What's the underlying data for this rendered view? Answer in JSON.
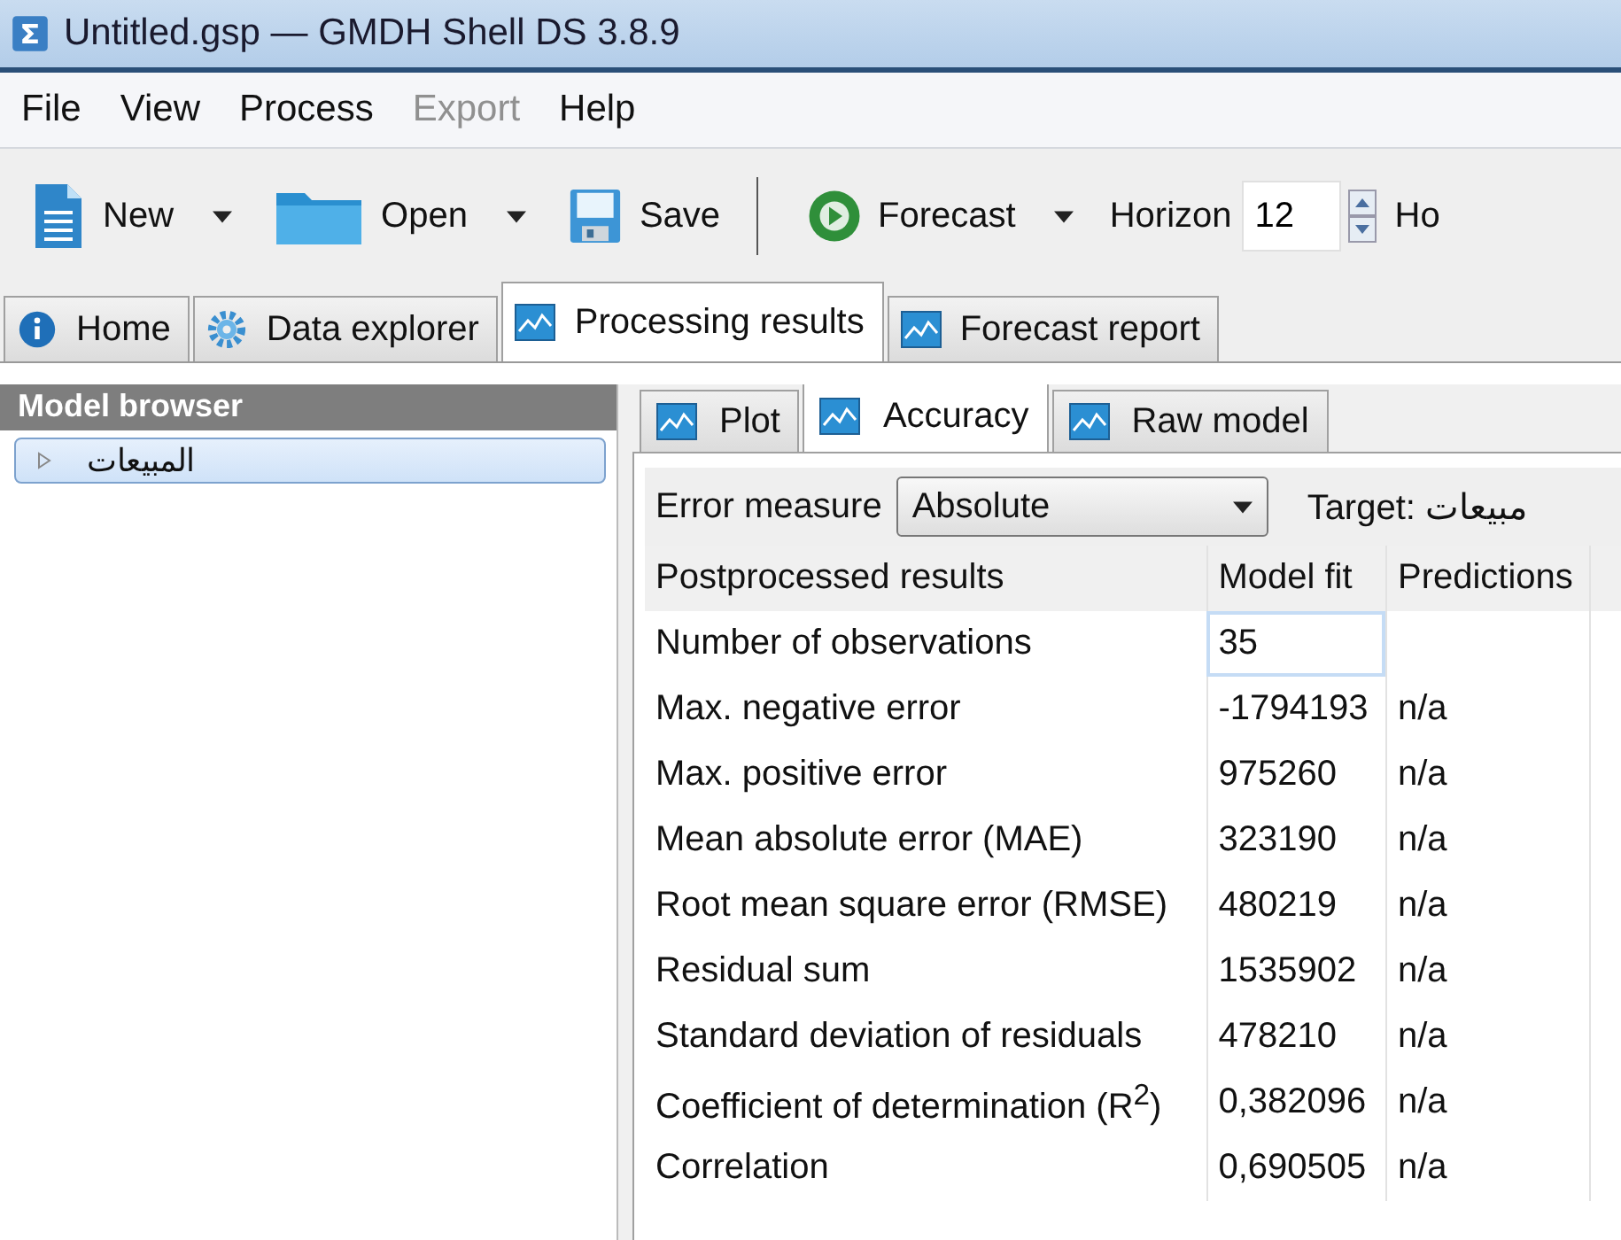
{
  "window": {
    "title": "Untitled.gsp — GMDH Shell DS 3.8.9"
  },
  "menu": [
    {
      "label": "File",
      "disabled": false
    },
    {
      "label": "View",
      "disabled": false
    },
    {
      "label": "Process",
      "disabled": false
    },
    {
      "label": "Export",
      "disabled": true
    },
    {
      "label": "Help",
      "disabled": false
    }
  ],
  "toolbar": {
    "buttons": [
      {
        "kind": "new",
        "label": "New",
        "dropdown": true
      },
      {
        "kind": "open",
        "label": "Open",
        "dropdown": true
      },
      {
        "kind": "save",
        "label": "Save",
        "dropdown": false
      },
      {
        "kind": "forecast",
        "label": "Forecast",
        "dropdown": true
      }
    ],
    "horizon": {
      "label": "Horizon",
      "value": "12"
    },
    "cut_label": "Ho"
  },
  "tabs": [
    {
      "kind": "info",
      "label": "Home",
      "selected": false
    },
    {
      "kind": "gear",
      "label": "Data explorer",
      "selected": false
    },
    {
      "kind": "chart",
      "label": "Processing results",
      "selected": true
    },
    {
      "kind": "chart",
      "label": "Forecast report",
      "selected": false
    }
  ],
  "sidebar": {
    "title": "Model browser",
    "items": [
      {
        "label": "المبيعات",
        "selected": true
      }
    ]
  },
  "subtabs": [
    {
      "label": "Plot",
      "selected": false
    },
    {
      "label": "Accuracy",
      "selected": true
    },
    {
      "label": "Raw model",
      "selected": false
    }
  ],
  "error_measure": {
    "label": "Error measure",
    "value": "Absolute"
  },
  "target": "Target: مبيعات",
  "table": {
    "columns": [
      "Postprocessed results",
      "Model fit",
      "Predictions"
    ],
    "rows": [
      {
        "cells": [
          "Number of observations",
          "35",
          ""
        ],
        "selected_cell": true
      },
      {
        "cells": [
          "Max. negative error",
          "-1794193",
          "n/a"
        ],
        "selected_cell": false
      },
      {
        "cells": [
          "Max. positive error",
          "975260",
          "n/a"
        ],
        "selected_cell": false
      },
      {
        "cells": [
          "Mean absolute error (MAE)",
          "323190",
          "n/a"
        ],
        "selected_cell": false
      },
      {
        "cells": [
          "Root mean square error (RMSE)",
          "480219",
          "n/a"
        ],
        "selected_cell": false
      },
      {
        "cells": [
          "Residual sum",
          "1535902",
          "n/a"
        ],
        "selected_cell": false
      },
      {
        "cells": [
          "Standard deviation of residuals",
          "478210",
          "n/a"
        ],
        "selected_cell": false
      },
      {
        "cells": [
          "Coefficient of determination (R$^{2}$)",
          "0,382096",
          "n/a"
        ],
        "selected_cell": false
      },
      {
        "cells": [
          "Correlation",
          "0,690505",
          "n/a"
        ],
        "selected_cell": false
      }
    ]
  }
}
